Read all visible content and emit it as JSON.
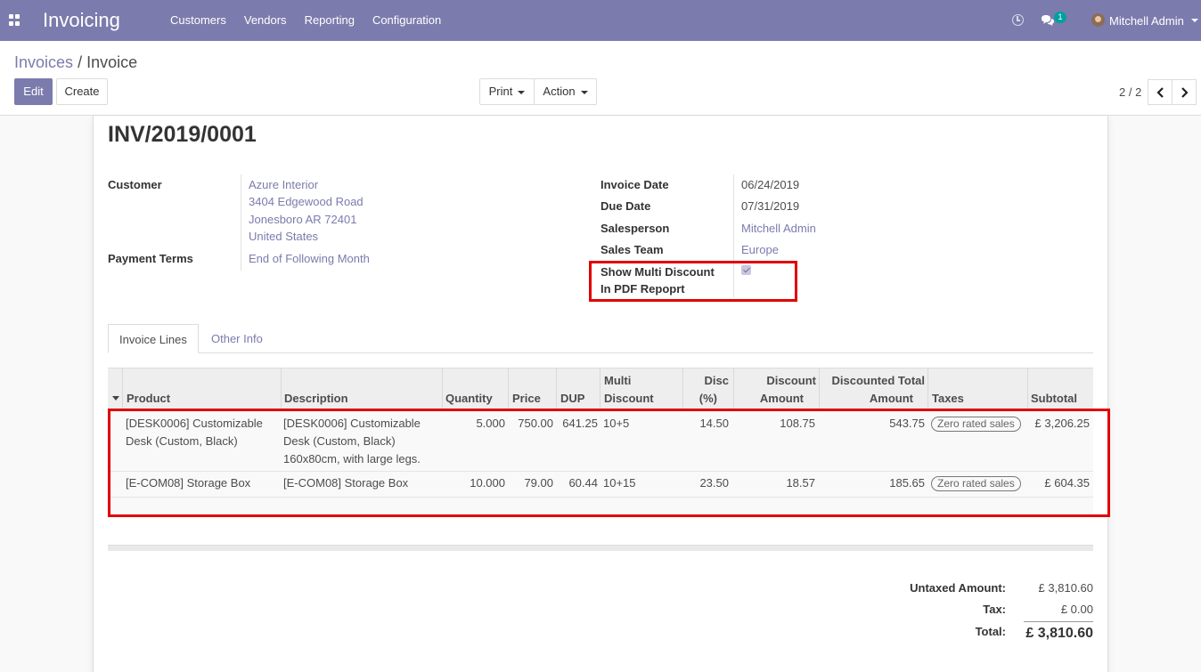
{
  "navbar": {
    "app_title": "Invoicing",
    "menu": [
      "Customers",
      "Vendors",
      "Reporting",
      "Configuration"
    ],
    "chat_count": "1",
    "user_name": "Mitchell Admin"
  },
  "control_panel": {
    "breadcrumb_parent": "Invoices",
    "breadcrumb_sep": "/",
    "breadcrumb_current": "Invoice",
    "edit_label": "Edit",
    "create_label": "Create",
    "print_label": "Print",
    "action_label": "Action",
    "pager": "2 / 2"
  },
  "invoice": {
    "number": "INV/2019/0001",
    "customer_label": "Customer",
    "customer_name": "Azure Interior",
    "address_line1": "3404 Edgewood Road",
    "address_line2": "Jonesboro AR 72401",
    "address_line3": "United States",
    "payment_terms_label": "Payment Terms",
    "payment_terms": "End of Following Month",
    "invoice_date_label": "Invoice Date",
    "invoice_date": "06/24/2019",
    "due_date_label": "Due Date",
    "due_date": "07/31/2019",
    "salesperson_label": "Salesperson",
    "salesperson": "Mitchell Admin",
    "sales_team_label": "Sales Team",
    "sales_team": "Europe",
    "multi_discount_label_1": "Show Multi Discount",
    "multi_discount_label_2": "In PDF Repoprt",
    "multi_discount_checked": true
  },
  "tabs": [
    "Invoice Lines",
    "Other Info"
  ],
  "lines_table": {
    "headers": {
      "product": "Product",
      "description": "Description",
      "quantity": "Quantity",
      "price": "Price",
      "dup": "DUP",
      "multi_1": "Multi",
      "multi_2": "Discount",
      "disc_1": "Disc",
      "disc_2": "(%)",
      "disc_amount_1": "Discount",
      "disc_amount_2": "Amount",
      "disc_total_1": "Discounted Total",
      "disc_total_2": "Amount",
      "taxes": "Taxes",
      "subtotal": "Subtotal"
    },
    "rows": [
      {
        "product_1": "[DESK0006] Customizable",
        "product_2": "Desk (Custom, Black)",
        "description_1": "[DESK0006] Customizable",
        "description_2": "Desk (Custom, Black)",
        "description_3": "160x80cm, with large legs.",
        "quantity": "5.000",
        "price": "750.00",
        "dup": "641.25",
        "multi_discount": "10+5",
        "disc": "14.50",
        "disc_amount": "108.75",
        "disc_total": "543.75",
        "tax": "Zero rated sales",
        "subtotal": "£ 3,206.25"
      },
      {
        "product_1": "[E-COM08] Storage Box",
        "description_1": "[E-COM08] Storage Box",
        "quantity": "10.000",
        "price": "79.00",
        "dup": "60.44",
        "multi_discount": "10+15",
        "disc": "23.50",
        "disc_amount": "18.57",
        "disc_total": "185.65",
        "tax": "Zero rated sales",
        "subtotal": "£ 604.35"
      }
    ]
  },
  "totals": {
    "untaxed_label": "Untaxed Amount:",
    "untaxed": "£ 3,810.60",
    "tax_label": "Tax:",
    "tax": "£ 0.00",
    "total_label": "Total:",
    "total": "£ 3,810.60"
  },
  "colors": {
    "brand": "#7c7bad",
    "highlight": "#e00000",
    "chat_badge": "#00a09d"
  }
}
